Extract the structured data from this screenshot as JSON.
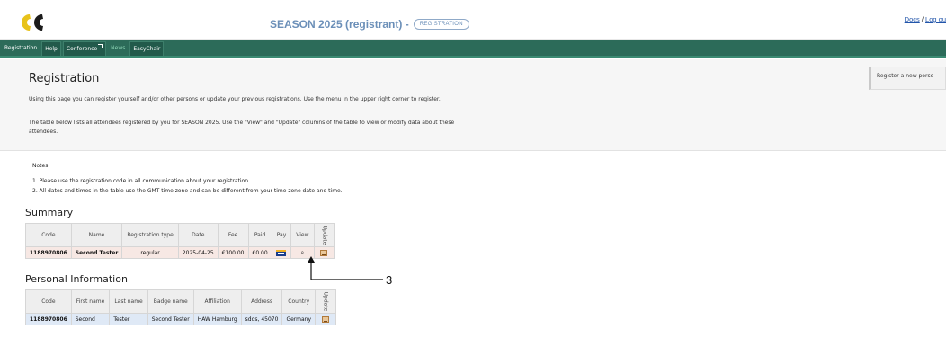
{
  "header": {
    "site_title": "SEASON 2025 (registrant) -",
    "role_badge": "REGISTRATION",
    "links": {
      "docs": "Docs",
      "separator": "/",
      "logout": "Log ou"
    }
  },
  "nav": {
    "items": [
      "Registration",
      "Help",
      "Conference",
      "News",
      "EasyChair"
    ]
  },
  "intro": {
    "title": "Registration",
    "p1": "Using this page you can register yourself and/or other persons or update your previous registrations. Use the menu in the upper right corner to register.",
    "p2": "The table below lists all attendees registered by you for SEASON 2025. Use the \"View\" and \"Update\" columns of the table to view or modify data about these attendees.",
    "side_link": "Register a new perso"
  },
  "notes": {
    "label": "Notes:",
    "items": [
      "1.  Please use the registration code in all communication about your registration.",
      "2.  All dates and times in the table use the GMT time zone and can be different from your time zone date and time."
    ]
  },
  "summary": {
    "title": "Summary",
    "headers": [
      "Code",
      "Name",
      "Registration type",
      "Date",
      "Fee",
      "Paid",
      "Pay",
      "View",
      "Update"
    ],
    "row": {
      "code": "1188970806",
      "name": "Second Tester",
      "type": "regular",
      "date": "2025-04-25",
      "fee": "€100.00",
      "paid": "€0.00"
    }
  },
  "personal": {
    "title": "Personal Information",
    "headers": [
      "Code",
      "First name",
      "Last name",
      "Badge name",
      "Affiliation",
      "Address",
      "Country",
      "Update"
    ],
    "row": {
      "code": "1188970806",
      "first": "Second",
      "last": "Tester",
      "badge": "Second Tester",
      "affiliation": "HAW Hamburg",
      "address": "sdds, 45070",
      "country": "Germany"
    }
  },
  "annotation": {
    "label": "3"
  },
  "colors": {
    "nav_bg": "#2c6b59",
    "title_blue": "#6b8fb8",
    "summary_row": "#f7e8e4",
    "personal_row": "#dfe9f6"
  }
}
